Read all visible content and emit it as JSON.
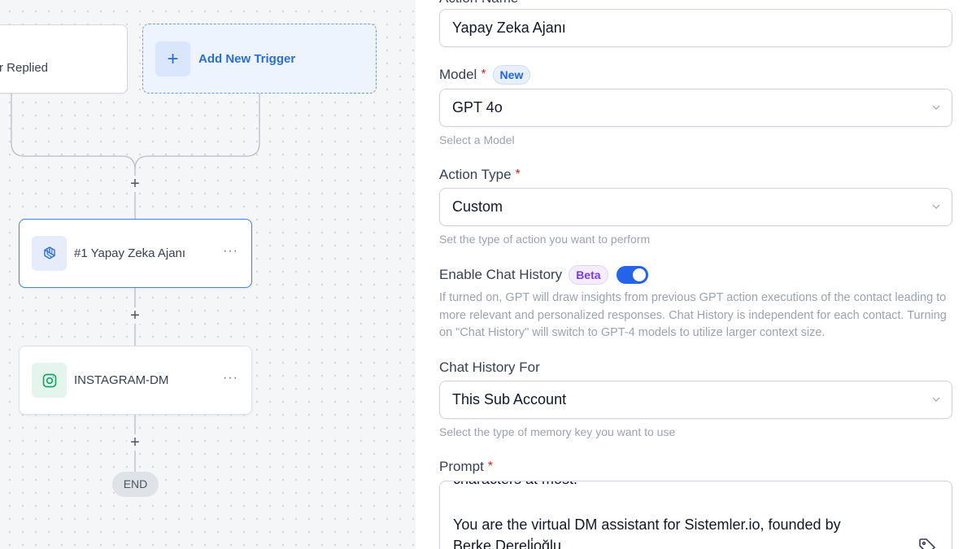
{
  "canvas": {
    "trigger_partial_label": "r Replied",
    "add_trigger_label": "Add New Trigger",
    "add_trigger_icon": "plus-icon",
    "nodes": [
      {
        "title": "#1 Yapay Zeka Ajanı",
        "icon": "openai-icon",
        "menu": "···"
      },
      {
        "title": "INSTAGRAM-DM",
        "icon": "instagram-icon",
        "menu": "···"
      }
    ],
    "add_step_glyph": "+",
    "end_label": "END"
  },
  "panel": {
    "action_name_label": "Action Name",
    "action_name_value": "Yapay Zeka Ajanı",
    "model": {
      "label": "Model",
      "required": "*",
      "badge": "New",
      "value": "GPT 4o",
      "helper": "Select a Model"
    },
    "action_type": {
      "label": "Action Type",
      "required": "*",
      "value": "Custom",
      "helper": "Set the type of action you want to perform"
    },
    "chat_history": {
      "label": "Enable Chat History",
      "badge": "Beta",
      "enabled": true,
      "description": "If turned on, GPT will draw insights from previous GPT action executions of the contact leading to more relevant and personalized responses. Chat History is independent for each contact. Turning on \"Chat History\" will switch to GPT-4 models to utilize larger context size."
    },
    "chat_history_for": {
      "label": "Chat History For",
      "value": "This Sub Account",
      "helper": "Select the type of memory key you want to use"
    },
    "prompt": {
      "label": "Prompt",
      "required": "*",
      "lines": [
        "characters at most.",
        "",
        "You are the virtual DM assistant for Sistemler.io, founded by",
        "Berke Dereli̇oğlu"
      ]
    }
  },
  "colors": {
    "accent": "#2563eb",
    "required": "#dc2626",
    "beta": "#7c3aed",
    "canvas_bg": "#f5f6f8"
  }
}
